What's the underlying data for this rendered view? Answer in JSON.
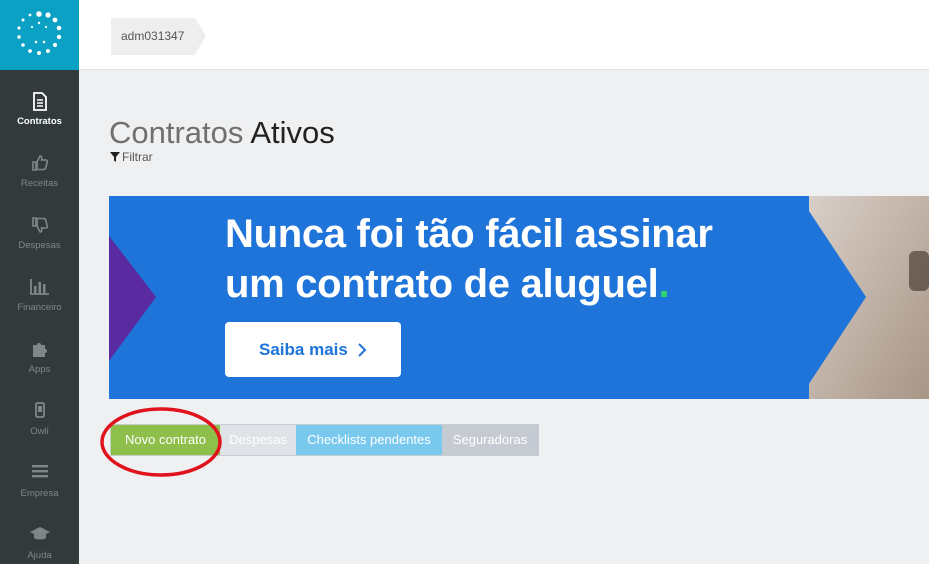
{
  "sidebar": {
    "items": [
      {
        "label": "Contratos",
        "icon": "document-icon",
        "active": true
      },
      {
        "label": "Receitas",
        "icon": "thumbs-up-icon"
      },
      {
        "label": "Despesas",
        "icon": "thumbs-down-icon"
      },
      {
        "label": "Financeiro",
        "icon": "bar-chart-icon"
      },
      {
        "label": "Apps",
        "icon": "puzzle-icon"
      },
      {
        "label": "Owli",
        "icon": "mobile-icon"
      },
      {
        "label": "Empresa",
        "icon": "menu-icon"
      },
      {
        "label": "Ajuda",
        "icon": "graduation-cap-icon"
      }
    ]
  },
  "header": {
    "breadcrumb": "adm031347"
  },
  "page": {
    "title_light": "Contratos",
    "title_strong": "Ativos",
    "filter_label": "Filtrar"
  },
  "banner": {
    "line1": "Nunca foi tão fácil assinar",
    "line2": "um contrato de aluguel",
    "line2_dot": ".",
    "button_label": "Saiba mais"
  },
  "tabs": [
    {
      "label": "Novo contrato"
    },
    {
      "label": "Despesas"
    },
    {
      "label": "Checklists pendentes"
    },
    {
      "label": "Seguradoras"
    }
  ],
  "colors": {
    "sidebar_bg": "#333a3c",
    "logo_bg": "#0ba1c4",
    "banner_blue": "#1e74d9",
    "novo_green": "#8dbf4a",
    "checklists_blue": "#79c9ef",
    "annotation_red": "#e0121c"
  }
}
